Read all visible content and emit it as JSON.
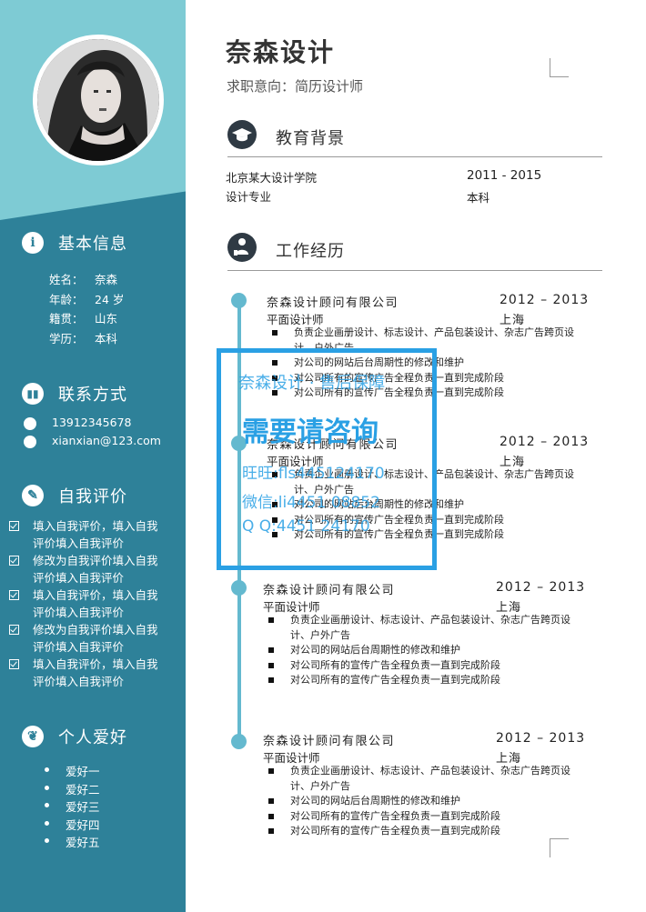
{
  "name": "奈森设计",
  "intent": "求职意向：简历设计师",
  "sidebar": {
    "basic": {
      "title": "基本信息",
      "icon": "info-icon",
      "rows": [
        {
          "k": "姓名：",
          "v": "奈森"
        },
        {
          "k": "年龄：",
          "v": "24 岁"
        },
        {
          "k": "籍贯：",
          "v": "山东"
        },
        {
          "k": "学历：",
          "v": "本科"
        }
      ]
    },
    "contact": {
      "title": "联系方式",
      "icon": "contact-card-icon",
      "phone": "13912345678",
      "email": "xianxian@123.com"
    },
    "evaluation": {
      "title": "自我评价",
      "icon": "pen-icon",
      "items": [
        "填入自我评价，填入自我评价填入自我评价",
        "修改为自我评价填入自我评价填入自我评价",
        "填入自我评价，填入自我评价填入自我评价",
        "修改为自我评价填入自我评价填入自我评价",
        "填入自我评价，填入自我评价填入自我评价"
      ]
    },
    "hobbies": {
      "title": "个人爱好",
      "icon": "leaf-icon",
      "items": [
        "爱好一",
        "爱好二",
        "爱好三",
        "爱好四",
        "爱好五"
      ]
    }
  },
  "education": {
    "title": "教育背景",
    "icon": "graduation-cap-icon",
    "school": "北京某大设计学院",
    "years": "2011 - 2015",
    "major": "设计专业",
    "degree": "本科"
  },
  "work": {
    "title": "工作经历",
    "icon": "worker-icon",
    "jobs": [
      {
        "company": "奈森设计顾问有限公司",
        "years": "2012 – 2013",
        "role": "平面设计师",
        "city": "上海",
        "duties": [
          "负责企业画册设计、标志设计、产品包装设计、杂志广告跨页设计、户外广告",
          "对公司的网站后台周期性的修改和维护",
          "对公司所有的宣传广告全程负责一直到完成阶段",
          "对公司所有的宣传广告全程负责一直到完成阶段"
        ]
      },
      {
        "company": "奈森设计顾问有限公司",
        "years": "2012 – 2013",
        "role": "平面设计师",
        "city": "上海",
        "duties": [
          "负责企业画册设计、标志设计、产品包装设计、杂志广告跨页设计、户外广告",
          "对公司的网站后台周期性的修改和维护",
          "对公司所有的宣传广告全程负责一直到完成阶段",
          "对公司所有的宣传广告全程负责一直到完成阶段"
        ]
      },
      {
        "company": "奈森设计顾问有限公司",
        "years": "2012 – 2013",
        "role": "平面设计师",
        "city": "上海",
        "duties": [
          "负责企业画册设计、标志设计、产品包装设计、杂志广告跨页设计、户外广告",
          "对公司的网站后台周期性的修改和维护",
          "对公司所有的宣传广告全程负责一直到完成阶段",
          "对公司所有的宣传广告全程负责一直到完成阶段"
        ]
      },
      {
        "company": "奈森设计顾问有限公司",
        "years": "2012 – 2013",
        "role": "平面设计师",
        "city": "上海",
        "duties": [
          "负责企业画册设计、标志设计、产品包装设计、杂志广告跨页设计、户外广告",
          "对公司的网站后台周期性的修改和维护",
          "对公司所有的宣传广告全程负责一直到完成阶段",
          "对公司所有的宣传广告全程负责一直到完成阶段"
        ]
      }
    ]
  },
  "watermark": {
    "line1": "奈森设计 · 售后保障",
    "line2": "需要请咨询",
    "line3": "旺旺:fls445124170",
    "line4": "微信:li4451 08852",
    "line5": "Q Q:4451 24170"
  },
  "colors": {
    "sidebar": "#2e8199",
    "sidebar_top": "#7ecbd4",
    "accent": "#64b9cf",
    "watermark": "#2aa0e4",
    "section_icon": "#2f3a44"
  }
}
